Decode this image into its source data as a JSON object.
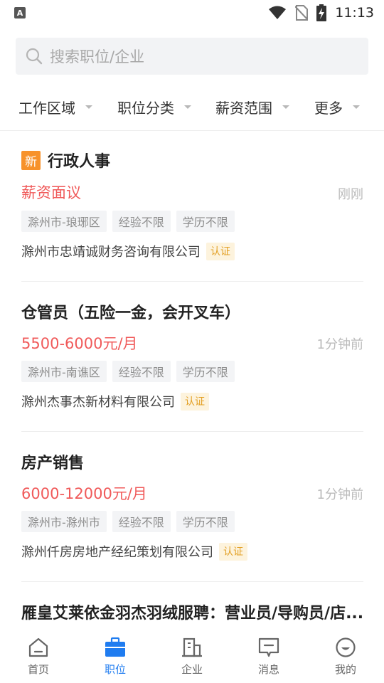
{
  "status_bar": {
    "time": "11:13",
    "left_icon_letter": "A"
  },
  "search": {
    "placeholder": "搜索职位/企业"
  },
  "filters": [
    {
      "label": "工作区域"
    },
    {
      "label": "职位分类"
    },
    {
      "label": "薪资范围"
    },
    {
      "label": "更多"
    }
  ],
  "jobs": [
    {
      "badge": "新",
      "title": "行政人事",
      "salary": "薪资面议",
      "time": "刚刚",
      "tags": [
        "滁州市-琅琊区",
        "经验不限",
        "学历不限"
      ],
      "company": "滁州市忠靖诚财务咨询有限公司",
      "verified": "认证"
    },
    {
      "title": "仓管员（五险一金，会开叉车）",
      "salary": "5500-6000元/月",
      "time": "1分钟前",
      "tags": [
        "滁州市-南谯区",
        "经验不限",
        "学历不限"
      ],
      "company": "滁州杰事杰新材料有限公司",
      "verified": "认证"
    },
    {
      "title": "房产销售",
      "salary": "6000-12000元/月",
      "time": "1分钟前",
      "tags": [
        "滁州市-滁州市",
        "经验不限",
        "学历不限"
      ],
      "company": "滁州仟房房地产经纪策划有限公司",
      "verified": "认证"
    },
    {
      "title": "雁皇艾莱依金羽杰羽绒服聘：营业员/导购员/店..."
    }
  ],
  "nav": [
    {
      "label": "首页",
      "icon": "home-icon"
    },
    {
      "label": "职位",
      "icon": "briefcase-icon"
    },
    {
      "label": "企业",
      "icon": "building-icon"
    },
    {
      "label": "消息",
      "icon": "message-icon"
    },
    {
      "label": "我的",
      "icon": "profile-icon"
    }
  ],
  "colors": {
    "accent_blue": "#1f7cf0",
    "salary_red": "#f05a5a",
    "new_badge_orange": "#f7922b",
    "verify_bg": "#fdf3dd",
    "verify_text": "#e3a025"
  }
}
